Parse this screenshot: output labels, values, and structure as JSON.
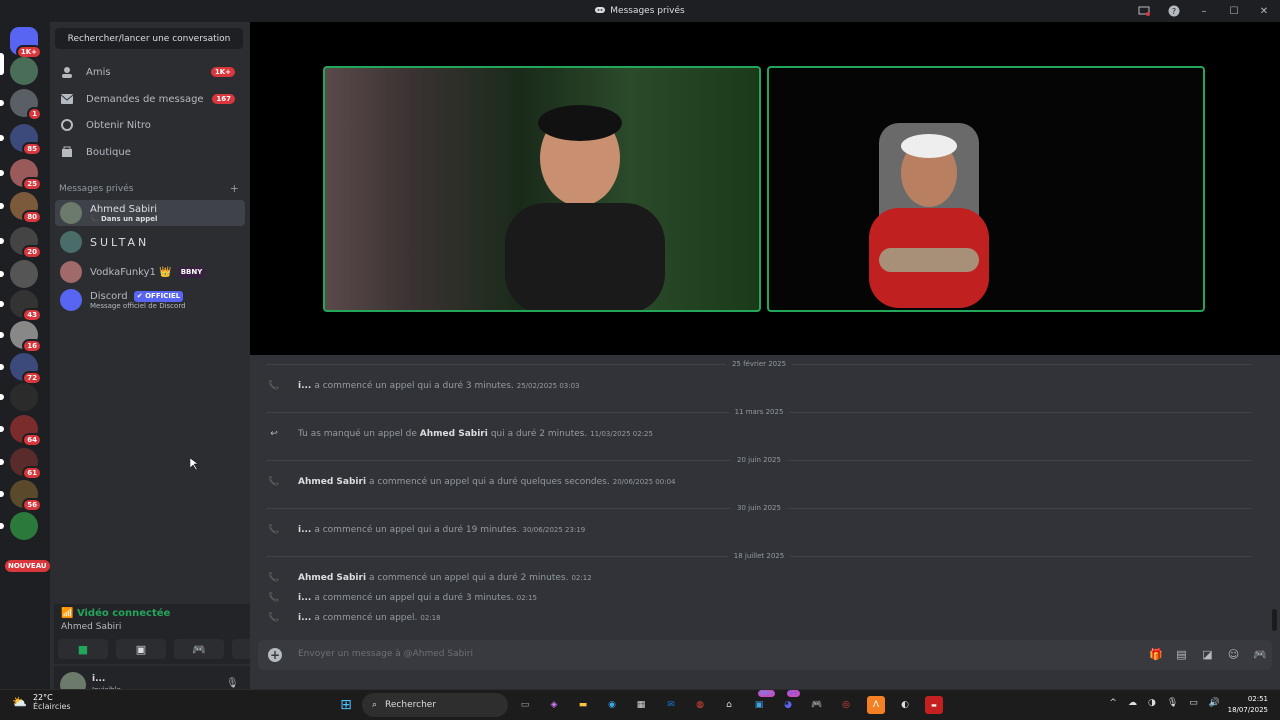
{
  "window": {
    "title": "Messages privés"
  },
  "servers": [
    {
      "badge": "1K+",
      "color": "#5865f2"
    },
    {
      "badge": "",
      "color": "#4a6d58"
    },
    {
      "badge": "1",
      "color": "#5a5f66"
    },
    {
      "badge": "85",
      "color": "#3b4a7a"
    },
    {
      "badge": "25",
      "color": "#9b5a5a"
    },
    {
      "badge": "80",
      "color": "#7a5a3b"
    },
    {
      "badge": "20",
      "color": "#444"
    },
    {
      "badge": "",
      "color": "#555"
    },
    {
      "badge": "43",
      "color": "#333"
    },
    {
      "badge": "16",
      "color": "#888"
    },
    {
      "badge": "72",
      "color": "#3b4a7a"
    },
    {
      "badge": "",
      "color": "#2b2b2b"
    },
    {
      "badge": "64",
      "color": "#7a2b2b"
    },
    {
      "badge": "61",
      "color": "#5a2b2b"
    },
    {
      "badge": "56",
      "color": "#5a4a2b"
    },
    {
      "badge": "",
      "color": "#2b7a3b"
    }
  ],
  "nouveau_label": "NOUVEAU",
  "sidebar": {
    "search_label": "Rechercher/lancer une conversation",
    "nav": [
      {
        "label": "Amis",
        "badge": "1K+",
        "icon": "friends-icon"
      },
      {
        "label": "Demandes de message",
        "badge": "167",
        "icon": "mail-icon"
      },
      {
        "label": "Obtenir Nitro",
        "badge": "",
        "icon": "nitro-icon"
      },
      {
        "label": "Boutique",
        "badge": "",
        "icon": "shop-icon"
      }
    ],
    "dm_header": "Messages privés",
    "dm_add": "+",
    "dms": [
      {
        "name": "Ahmed Sabiri",
        "sub": "Dans un appel",
        "tag": "",
        "active": true
      },
      {
        "name": "SULTAN",
        "sub": "",
        "tag": "",
        "active": false
      },
      {
        "name": "VodkaFunky1 👑",
        "sub": "",
        "tag": "BBNY",
        "active": false
      },
      {
        "name": "Discord",
        "sub": "Message officiel de Discord",
        "tag": "✔ OFFICIEL",
        "active": false
      }
    ]
  },
  "voice": {
    "status": "Vidéo connectée",
    "user": "Ahmed Sabiri"
  },
  "user": {
    "name": "i...",
    "status": "Invisible"
  },
  "messages": {
    "dates": [
      "25 février 2025",
      "11 mars 2025",
      "20 juin 2025",
      "30 juin 2025",
      "18 juillet 2025"
    ],
    "items": [
      {
        "bold": "i...",
        "text": "a commencé un appel qui a duré 3 minutes.",
        "ts": "25/02/2025 03:03",
        "missed": false
      },
      {
        "pre": "Tu as manqué un appel de ",
        "bold": "Ahmed Sabiri",
        "text": "qui a duré 2 minutes.",
        "ts": "11/03/2025 02:25",
        "missed": true
      },
      {
        "bold": "Ahmed Sabiri",
        "text": "a commencé un appel qui a duré quelques secondes.",
        "ts": "20/06/2025 00:04",
        "missed": false
      },
      {
        "bold": "i...",
        "text": "a commencé un appel qui a duré 19 minutes.",
        "ts": "30/06/2025 23:19",
        "missed": false
      },
      {
        "bold": "Ahmed Sabiri",
        "text": "a commencé un appel qui a duré 2 minutes.",
        "ts": "02:12",
        "missed": false
      },
      {
        "bold": "i...",
        "text": "a commencé un appel qui a duré 3 minutes.",
        "ts": "02:15",
        "missed": false
      },
      {
        "bold": "i...",
        "text": "a commencé un appel.",
        "ts": "02:18",
        "missed": false
      }
    ]
  },
  "composer": {
    "placeholder": "Envoyer un message à @Ahmed Sabiri"
  },
  "taskbar": {
    "temp": "22°C",
    "weather": "Éclaircies",
    "search": "Rechercher",
    "time": "02:51",
    "date": "18/07/2025",
    "badge_99": "99+",
    "badge_9": "9+"
  }
}
